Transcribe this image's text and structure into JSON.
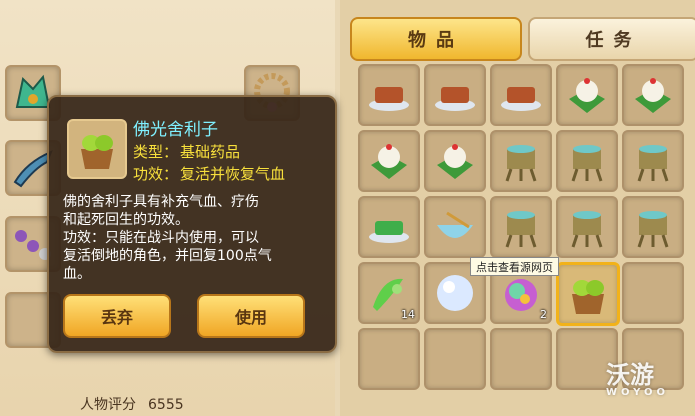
{
  "tabs": {
    "items": "物品",
    "tasks": "任务"
  },
  "popup": {
    "name": "佛光舍利子",
    "type_label": "类型：",
    "type_value": "基础药品",
    "effect_label": "功效：",
    "effect_value": "复活并恢复气血",
    "desc_lines": [
      "佛的舍利子具有补充气血、疗伤",
      "和起死回生的功效。",
      "功效：只能在战斗内使用，可以",
      "复活倒地的角色，并回复100点气",
      "血。"
    ],
    "discard_label": "丢弃",
    "use_label": "使用"
  },
  "hover_tip": "点击查看源网页",
  "rating": {
    "label": "人物评分",
    "value": "6555"
  },
  "inventory_counts": {
    "herb": "14",
    "orb": "2"
  },
  "watermark": {
    "brand": "沃游",
    "sub": "WOYOO"
  },
  "colors": {
    "item_name": "#7ff0ff",
    "item_stat": "#f8e03c",
    "tab_active": "#f0b72e"
  }
}
